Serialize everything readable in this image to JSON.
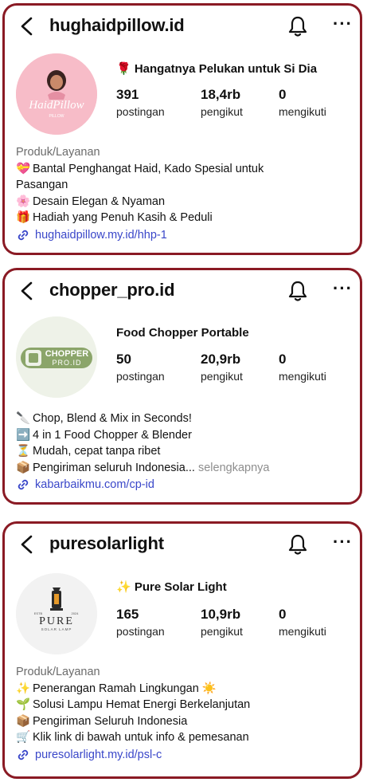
{
  "profiles": [
    {
      "handle": "hughaidpillow.id",
      "display_name": "🌹 Hangatnya Pelukan untuk Si Dia",
      "avatar_text": "HaidPillow",
      "avatar_sub": "PILLOW",
      "stats": [
        {
          "value": "391",
          "label": "postingan"
        },
        {
          "value": "18,4rb",
          "label": "pengikut"
        },
        {
          "value": "0",
          "label": "mengikuti"
        }
      ],
      "category": "Produk/Layanan",
      "bio": [
        {
          "emoji": "💝",
          "text": "Bantal Penghangat Haid, Kado Spesial untuk"
        },
        {
          "emoji": "",
          "text": "Pasangan"
        },
        {
          "emoji": "🌸",
          "text": "Desain Elegan & Nyaman"
        },
        {
          "emoji": "🎁",
          "text": "Hadiah yang Penuh Kasih & Peduli"
        }
      ],
      "link": "hughaidpillow.my.id/hhp-1"
    },
    {
      "handle": "chopper_pro.id",
      "display_name": "Food Chopper Portable",
      "avatar_text": "CHOPPER",
      "avatar_sub": "PRO.ID",
      "stats": [
        {
          "value": "50",
          "label": "postingan"
        },
        {
          "value": "20,9rb",
          "label": "pengikut"
        },
        {
          "value": "0",
          "label": "mengikuti"
        }
      ],
      "category": "",
      "bio": [
        {
          "emoji": "🔪",
          "text": "Chop, Blend & Mix in Seconds!"
        },
        {
          "emoji": "➡️",
          "text": "4 in 1 Food Chopper & Blender"
        },
        {
          "emoji": "⏳",
          "text": "Mudah, cepat tanpa ribet"
        },
        {
          "emoji": "📦",
          "text": "Pengiriman seluruh Indonesia..."
        }
      ],
      "more_label": "selengkapnya",
      "link": "kabarbaikmu.com/cp-id"
    },
    {
      "handle": "puresolarlight",
      "display_name": "✨ Pure Solar Light",
      "avatar_text": "PURE",
      "avatar_sub": "SOLAR LAMP",
      "avatar_est": "ESTB",
      "avatar_year": "2024",
      "stats": [
        {
          "value": "165",
          "label": "postingan"
        },
        {
          "value": "10,9rb",
          "label": "pengikut"
        },
        {
          "value": "0",
          "label": "mengikuti"
        }
      ],
      "category": "Produk/Layanan",
      "bio": [
        {
          "emoji": "✨",
          "text": "Penerangan Ramah Lingkungan ☀️"
        },
        {
          "emoji": "🌱",
          "text": "Solusi Lampu Hemat Energi Berkelanjutan"
        },
        {
          "emoji": "📦",
          "text": "Pengiriman Seluruh Indonesia"
        },
        {
          "emoji": "🛒",
          "text": "Klik link di bawah untuk info & pemesanan"
        }
      ],
      "link": "puresolarlight.my.id/psl-c"
    }
  ]
}
